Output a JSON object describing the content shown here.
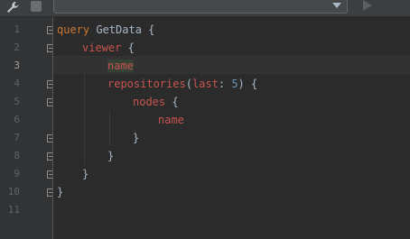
{
  "toolbar": {
    "operation_select": {
      "value": ""
    }
  },
  "gutter": {
    "line_numbers": [
      "1",
      "2",
      "3",
      "4",
      "5",
      "6",
      "7",
      "8",
      "9",
      "10",
      "11"
    ],
    "active_line": "3"
  },
  "code": {
    "line1": {
      "keyword": "query",
      "name": "GetData",
      "brace": "{"
    },
    "line2": {
      "field": "viewer",
      "brace": "{"
    },
    "line3": {
      "field": "name"
    },
    "line4": {
      "field": "repositories",
      "open_paren": "(",
      "arg": "last",
      "colon": ":",
      "value": "5",
      "close_paren": ")",
      "brace": "{"
    },
    "line5": {
      "field": "nodes",
      "brace": "{"
    },
    "line6": {
      "field": "name"
    },
    "line7": {
      "brace": "}"
    },
    "line8": {
      "brace": "}"
    },
    "line9": {
      "brace": "}"
    },
    "line10": {
      "brace": "}"
    }
  },
  "colors": {
    "background": "#2b2b2b",
    "gutter": "#313335",
    "keyword": "#cc7832",
    "field": "#c75450",
    "text": "#a9b7c6",
    "number": "#6897bb",
    "caret_row": "#323232"
  },
  "icons": [
    "wrench-icon",
    "stop-icon",
    "dropdown-arrow-icon",
    "run-icon",
    "fold-icon"
  ]
}
